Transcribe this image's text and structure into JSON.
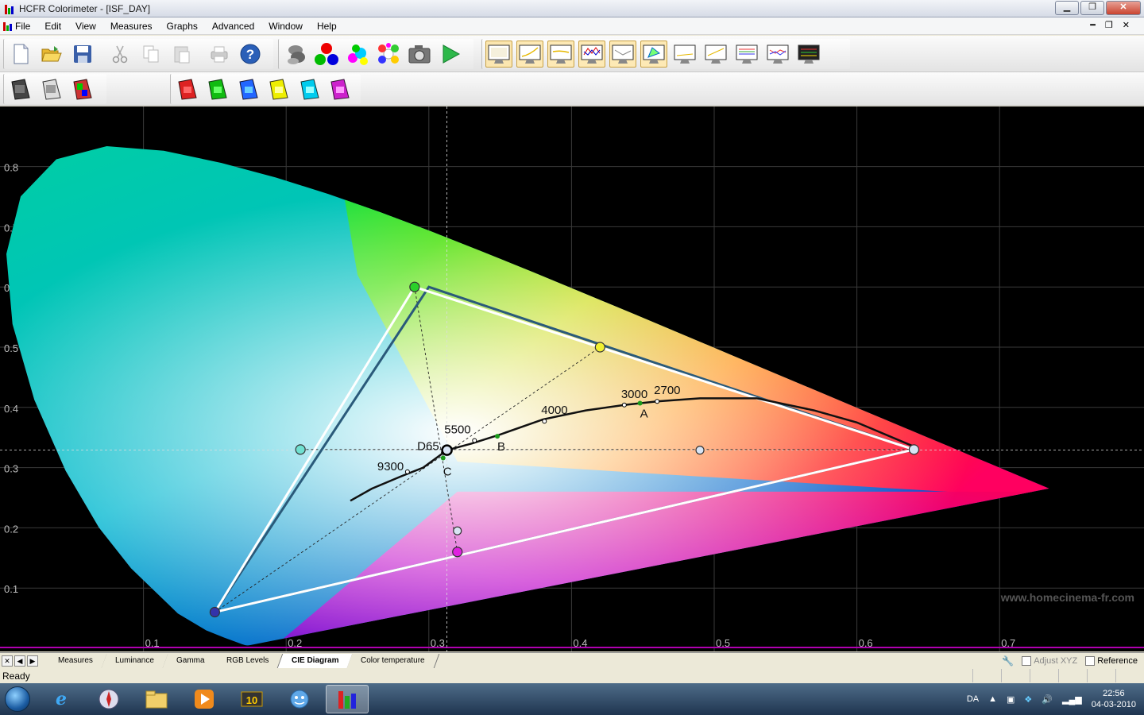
{
  "window": {
    "title": "HCFR Colorimeter - [ISF_DAY]"
  },
  "menu": [
    "File",
    "Edit",
    "View",
    "Measures",
    "Graphs",
    "Advanced",
    "Window",
    "Help"
  ],
  "toolbar1": {
    "file_tools": [
      "new-icon",
      "open-icon",
      "save-icon"
    ],
    "edit_tools": [
      "cut-icon",
      "copy-icon",
      "paste-icon"
    ],
    "misc_tools": [
      "print-icon",
      "help-icon"
    ],
    "measure_tools": [
      "sensor-icon",
      "rgb-measure-icon",
      "color-measure-icon",
      "multi-color-icon",
      "camera-icon",
      "play-icon"
    ],
    "graph_tools": [
      "cie-view-icon",
      "luminance-view-icon",
      "gamma-view-icon",
      "rgb-levels-view-icon",
      "color-temp-view-icon",
      "cie-diagram-icon",
      "view7-icon",
      "view8-icon",
      "view9-icon",
      "view10-icon",
      "view11-icon"
    ]
  },
  "toolbar2": {
    "left_tools": [
      "measure-gray-icon",
      "measure-near-black-icon",
      "measure-primaries-icon"
    ],
    "right_tools": [
      "measure-red-icon",
      "measure-green-icon",
      "measure-blue-icon",
      "measure-yellow-icon",
      "measure-cyan-icon",
      "measure-magenta-icon"
    ]
  },
  "chart_data": {
    "type": "scatter",
    "title": "",
    "xlabel": "",
    "ylabel": "",
    "xlim": [
      0.0,
      0.8
    ],
    "ylim": [
      0.0,
      0.9
    ],
    "x_ticks": [
      "0.1",
      "0.2",
      "0.3",
      "0.4",
      "0.5",
      "0.6",
      "0.7"
    ],
    "y_ticks": [
      "0.1",
      "0.2",
      "0.3",
      "0.4",
      "0.5",
      "0.6",
      "0.7",
      "0.8"
    ],
    "grid": true,
    "watermark": "www.homecinema-fr.com",
    "reference_gamut": {
      "red": [
        0.64,
        0.33
      ],
      "green": [
        0.3,
        0.6
      ],
      "blue": [
        0.15,
        0.06
      ]
    },
    "measured_gamut": {
      "red": [
        0.64,
        0.33
      ],
      "green": [
        0.29,
        0.6
      ],
      "blue": [
        0.15,
        0.06
      ]
    },
    "measured_secondaries": {
      "yellow": [
        0.42,
        0.5
      ],
      "cyan": [
        0.21,
        0.33
      ],
      "magenta": [
        0.32,
        0.16
      ]
    },
    "white_point": [
      0.3127,
      0.329
    ],
    "planckian_locus": [
      [
        0.245,
        0.245
      ],
      [
        0.26,
        0.265
      ],
      [
        0.28,
        0.285
      ],
      [
        0.296,
        0.3
      ],
      [
        0.3127,
        0.329
      ],
      [
        0.33,
        0.34
      ],
      [
        0.35,
        0.355
      ],
      [
        0.38,
        0.38
      ],
      [
        0.41,
        0.395
      ],
      [
        0.437,
        0.404
      ],
      [
        0.46,
        0.41
      ],
      [
        0.49,
        0.415
      ],
      [
        0.53,
        0.415
      ],
      [
        0.57,
        0.395
      ],
      [
        0.6,
        0.375
      ],
      [
        0.64,
        0.335
      ]
    ],
    "temperature_labels": [
      {
        "label": "9300",
        "x": 0.285,
        "y": 0.293
      },
      {
        "label": "D65",
        "x": 0.313,
        "y": 0.329
      },
      {
        "label": "5500",
        "x": 0.332,
        "y": 0.345
      },
      {
        "label": "4000",
        "x": 0.381,
        "y": 0.377
      },
      {
        "label": "3000",
        "x": 0.437,
        "y": 0.404
      },
      {
        "label": "2700",
        "x": 0.46,
        "y": 0.41
      }
    ],
    "illuminants": [
      {
        "label": "A",
        "x": 0.448,
        "y": 0.407
      },
      {
        "label": "B",
        "x": 0.348,
        "y": 0.352
      },
      {
        "label": "C",
        "x": 0.31,
        "y": 0.316
      }
    ],
    "measured_points": [
      {
        "name": "gray-point-1",
        "x": 0.49,
        "y": 0.329
      },
      {
        "name": "gray-point-2",
        "x": 0.32,
        "y": 0.195
      }
    ]
  },
  "tabs": {
    "nav": [
      "✕",
      "◀",
      "▶"
    ],
    "items": [
      "Measures",
      "Luminance",
      "Gamma",
      "RGB Levels",
      "CIE Diagram",
      "Color temperature"
    ],
    "active": "CIE Diagram",
    "adjust_xyz": "Adjust XYZ",
    "reference": "Reference"
  },
  "status": {
    "text": "Ready"
  },
  "taskbar": {
    "apps": [
      "ie-icon",
      "safari-icon",
      "explorer-icon",
      "media-player-icon",
      "game-icon",
      "messenger-icon",
      "hcfr-icon"
    ],
    "language": "DA",
    "time": "22:56",
    "date": "04-03-2010"
  }
}
